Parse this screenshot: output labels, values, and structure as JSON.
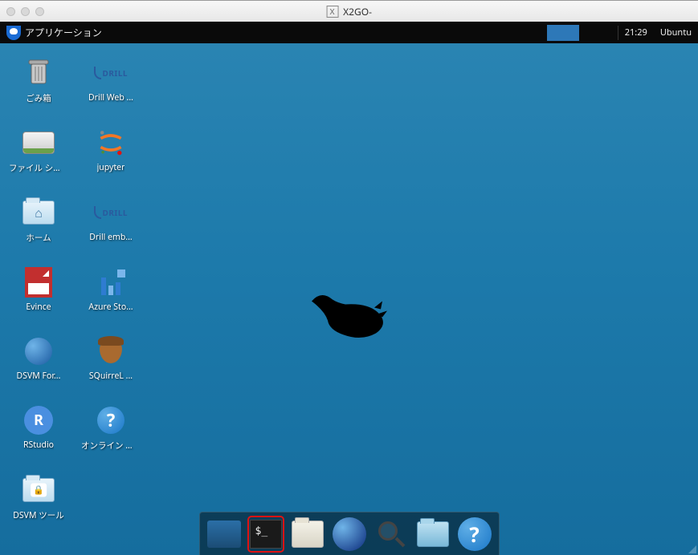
{
  "window": {
    "title": "X2GO-",
    "x_badge": "X"
  },
  "panel": {
    "apps_label": "アプリケーション",
    "clock": "21:29",
    "user": "Ubuntu"
  },
  "desktop_icons": {
    "row0": [
      {
        "id": "trash",
        "label": "ごみ箱"
      },
      {
        "id": "drill-web",
        "label": "Drill Web ..."
      }
    ],
    "row1": [
      {
        "id": "filesystem",
        "label": "ファイル システム"
      },
      {
        "id": "jupyter",
        "label": "jupyter"
      }
    ],
    "row2": [
      {
        "id": "home",
        "label": "ホーム"
      },
      {
        "id": "drill-emb",
        "label": "Drill emb..."
      }
    ],
    "row3": [
      {
        "id": "evince",
        "label": "Evince"
      },
      {
        "id": "azure-sto",
        "label": "Azure Sto..."
      }
    ],
    "row4": [
      {
        "id": "dsvm-for",
        "label": "DSVM For..."
      },
      {
        "id": "squirrel",
        "label": "SQuirreL ..."
      }
    ],
    "row5": [
      {
        "id": "rstudio",
        "label": "RStudio"
      },
      {
        "id": "online-help",
        "label": "オンライン ヘルプ"
      }
    ],
    "row6": [
      {
        "id": "dsvm-tool",
        "label": "DSVM ツール"
      }
    ]
  },
  "drill_text": "DRILL",
  "r_letter": "R",
  "help_mark": "?",
  "dock": {
    "items": [
      {
        "id": "show-desktop",
        "selected": false
      },
      {
        "id": "terminal",
        "selected": true
      },
      {
        "id": "file-manager",
        "selected": false
      },
      {
        "id": "web-browser",
        "selected": false
      },
      {
        "id": "app-finder",
        "selected": false
      },
      {
        "id": "home-folder",
        "selected": false
      },
      {
        "id": "help",
        "selected": false
      }
    ]
  }
}
